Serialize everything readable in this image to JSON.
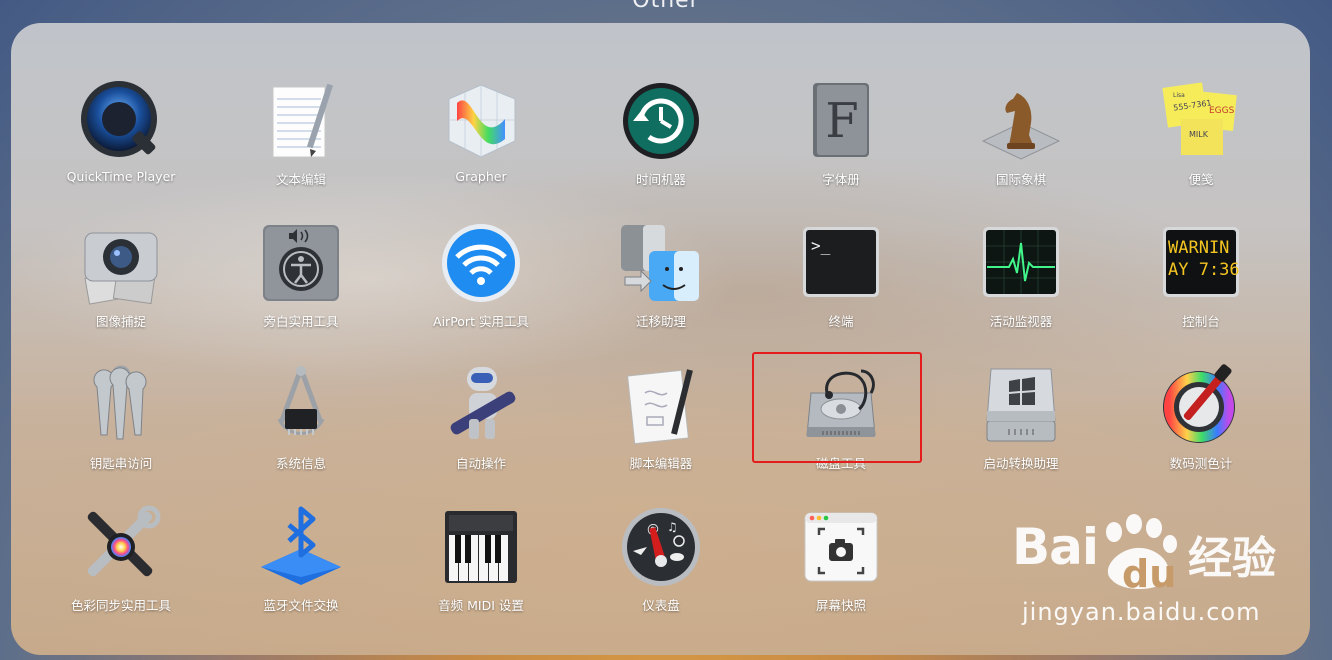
{
  "folder": {
    "title": "Other"
  },
  "apps": [
    {
      "label": "QuickTime Player",
      "icon": "quicktime-icon"
    },
    {
      "label": "文本编辑",
      "icon": "textedit-icon"
    },
    {
      "label": "Grapher",
      "icon": "grapher-icon"
    },
    {
      "label": "时间机器",
      "icon": "time-machine-icon"
    },
    {
      "label": "字体册",
      "icon": "font-book-icon"
    },
    {
      "label": "国际象棋",
      "icon": "chess-icon"
    },
    {
      "label": "便笺",
      "icon": "stickies-icon"
    },
    {
      "label": "图像捕捉",
      "icon": "image-capture-icon"
    },
    {
      "label": "旁白实用工具",
      "icon": "voiceover-icon"
    },
    {
      "label": "AirPort 实用工具",
      "icon": "airport-icon"
    },
    {
      "label": "迁移助理",
      "icon": "migration-assistant-icon"
    },
    {
      "label": "终端",
      "icon": "terminal-icon"
    },
    {
      "label": "活动监视器",
      "icon": "activity-monitor-icon"
    },
    {
      "label": "控制台",
      "icon": "console-icon"
    },
    {
      "label": "钥匙串访问",
      "icon": "keychain-icon"
    },
    {
      "label": "系统信息",
      "icon": "system-information-icon"
    },
    {
      "label": "自动操作",
      "icon": "automator-icon"
    },
    {
      "label": "脚本编辑器",
      "icon": "script-editor-icon"
    },
    {
      "label": "磁盘工具",
      "icon": "disk-utility-icon"
    },
    {
      "label": "启动转换助理",
      "icon": "boot-camp-icon"
    },
    {
      "label": "数码测色计",
      "icon": "color-meter-icon"
    },
    {
      "label": "色彩同步实用工具",
      "icon": "colorsync-icon"
    },
    {
      "label": "蓝牙文件交换",
      "icon": "bluetooth-icon"
    },
    {
      "label": "音频 MIDI 设置",
      "icon": "audio-midi-icon"
    },
    {
      "label": "仪表盘",
      "icon": "dashboard-icon"
    },
    {
      "label": "屏幕快照",
      "icon": "screenshot-icon"
    }
  ],
  "terminal": {
    "prompt": ">_"
  },
  "console": {
    "line1": "WARNIN",
    "line2": "AY 7:36"
  },
  "font_book": {
    "letter": "F"
  },
  "stickies": {
    "note1": "555-7361",
    "note2": "EGGS",
    "note3": "MILK",
    "note4": "Lisa"
  },
  "watermark": {
    "brand": "Bai",
    "du": "du",
    "cn": "经验",
    "url": "jingyan.baidu.com"
  },
  "highlight_color": "#e41c1c"
}
